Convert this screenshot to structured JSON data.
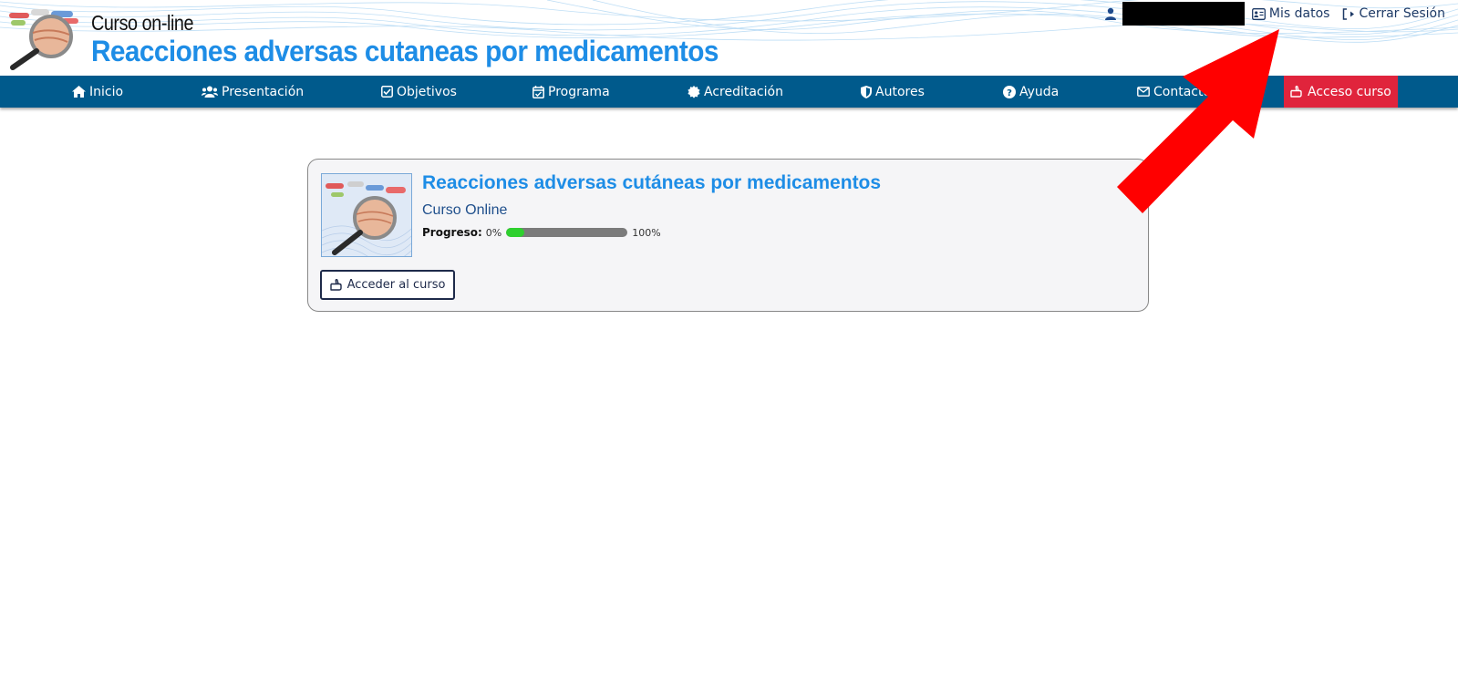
{
  "header": {
    "subtitle": "Curso on-line",
    "title": "Reacciones adversas cutaneas por medicamentos"
  },
  "user_bar": {
    "username": "",
    "my_data_label": "Mis datos",
    "logout_label": "Cerrar Sesión"
  },
  "nav": {
    "items": [
      {
        "label": "Inicio",
        "icon": "home-icon"
      },
      {
        "label": "Presentación",
        "icon": "users-icon"
      },
      {
        "label": "Objetivos",
        "icon": "checkbox-icon"
      },
      {
        "label": "Programa",
        "icon": "calendar-check-icon"
      },
      {
        "label": "Acreditación",
        "icon": "certificate-icon"
      },
      {
        "label": "Autores",
        "icon": "shield-icon"
      },
      {
        "label": "Ayuda",
        "icon": "question-icon"
      },
      {
        "label": "Contacto",
        "icon": "envelope-icon"
      },
      {
        "label": "Acceso curso",
        "icon": "hand-pointer-icon",
        "active": true
      }
    ]
  },
  "course": {
    "title": "Reacciones adversas cutáneas por medicamentos",
    "type": "Curso Online",
    "progress_label": "Progreso:",
    "progress_min": "0%",
    "progress_max": "100%",
    "progress_value": 0.15,
    "access_label": "Acceder al curso"
  },
  "colors": {
    "brand_blue": "#1e8de6",
    "nav_bg": "#005a8c",
    "active_nav": "#e0243c",
    "progress_fill": "#2ed02e",
    "annotation_arrow": "#ff0000"
  }
}
